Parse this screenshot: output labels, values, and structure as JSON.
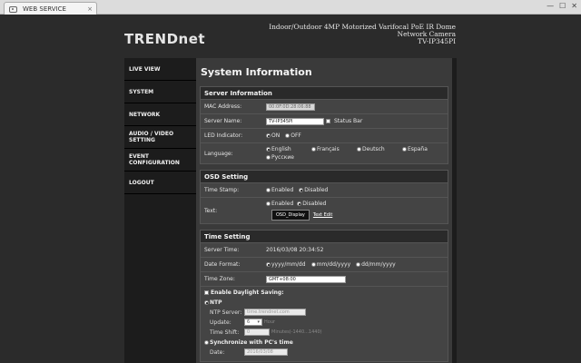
{
  "browser": {
    "tab_title": "WEB SERVICE",
    "tab_close": "×",
    "min": "—",
    "max": "☐",
    "close": "✕"
  },
  "brand": {
    "logo": "TRENDnet",
    "model_line1": "Indoor/Outdoor 4MP Motorized Varifocal PoE IR Dome",
    "model_line2": "Network Camera",
    "model_line3": "TV-IP345PI"
  },
  "nav": [
    "LIVE VIEW",
    "SYSTEM",
    "NETWORK",
    "AUDIO / VIDEO SETTING",
    "EVENT CONFIGURATION",
    "LOGOUT"
  ],
  "page_title": "System Information",
  "server_info": {
    "header": "Server Information",
    "mac_label": "MAC Address:",
    "mac_value": "00:0F:0D:28:06:88",
    "name_label": "Server Name:",
    "name_value": "TV-IP345PI",
    "status_bar": "Status Bar",
    "led_label": "LED Indicator:",
    "led_on": "ON",
    "led_off": "OFF",
    "lang_label": "Language:",
    "languages": [
      "English",
      "Français",
      "Deutsch",
      "España",
      "Pусские"
    ]
  },
  "osd": {
    "header": "OSD Setting",
    "timestamp_label": "Time Stamp:",
    "enabled": "Enabled",
    "disabled": "Disabled",
    "text_label": "Text:",
    "osd_text": "OSD_Display",
    "text_edit": "Text Edit"
  },
  "time": {
    "header": "Time Setting",
    "server_time_label": "Server Time:",
    "server_time": "2016/03/08 20:34:52",
    "date_format_label": "Date Format:",
    "fmt1": "yyyy/mm/dd",
    "fmt2": "mm/dd/yyyy",
    "fmt3": "dd/mm/yyyy",
    "zone_label": "Time Zone:",
    "zone_value": "GMT+08:00",
    "daylight": "Enable Daylight Saving:",
    "ntp": "NTP",
    "ntp_server_label": "NTP Server:",
    "ntp_server": "time.trendnet.com",
    "update_label": "Update:",
    "update_value": "6",
    "update_unit": "Hour",
    "shift_label": "Time Shift:",
    "shift_value": "0",
    "shift_hint": "Minutes(-1440...1440)",
    "sync_pc": "Synchronize with PC's time",
    "date_label": "Date:",
    "date_value": "2016/03/08"
  }
}
